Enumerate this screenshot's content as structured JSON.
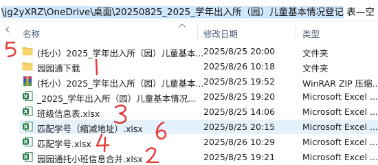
{
  "window": {
    "address_path": "\\jg2yXRZ\\OneDrive\\桌面\\20250825_2025_学年出入所（园）儿童基本情况登记",
    "address_suffix": " 表—空"
  },
  "columns": {
    "name": "名称",
    "modified": "修改日期",
    "type": "类型"
  },
  "files": [
    {
      "name": "(托小）2025_学年出入所（园）儿童基本...",
      "date": "2025/8/25 20:00",
      "type": "文件夹",
      "icon": "folder-icon"
    },
    {
      "name": "园园通下载",
      "date": "2025/8/26 10:18",
      "type": "文件夹",
      "icon": "folder-icon"
    },
    {
      "name": "(托小）2025_学年出入所（园）儿童基本...",
      "date": "2025/8/25 19:52",
      "type": "WinRAR ZIP 压缩...",
      "icon": "winrar-archive-icon"
    },
    {
      "name": "_2025_学年出入所（园）儿童基本情况...",
      "date": "2025/8/25 19:20",
      "type": "Microsoft Excel ...",
      "icon": "excel-file-icon"
    },
    {
      "name": "班级信息表.xlsx",
      "date": "2025/8/25 14:06",
      "type": "Microsoft Excel ...",
      "icon": "excel-file-icon"
    },
    {
      "name": "匹配学号（缩减地址）.xlsx",
      "date": "2025/8/25 20:15",
      "type": "Microsoft Excel ...",
      "icon": "excel-file-icon"
    },
    {
      "name": "匹配学号.xlsx",
      "date": "2025/8/26 10:29",
      "type": "Microsoft Excel ...",
      "icon": "excel-file-icon"
    },
    {
      "name": "园园通托小班信息合并.xlsx",
      "date": "2025/8/25 19:21",
      "type": "Microsoft Excel ...",
      "icon": "excel-file-icon"
    }
  ],
  "annotations": {
    "n5": "5",
    "n1": "1",
    "n3": "3",
    "n6": "6",
    "n4": "4",
    "n2": "2"
  },
  "colors": {
    "selection": "#e5f1fb",
    "folder": "#f2c94c",
    "excel": "#1f7a45",
    "annotation": "#e23e3e"
  }
}
